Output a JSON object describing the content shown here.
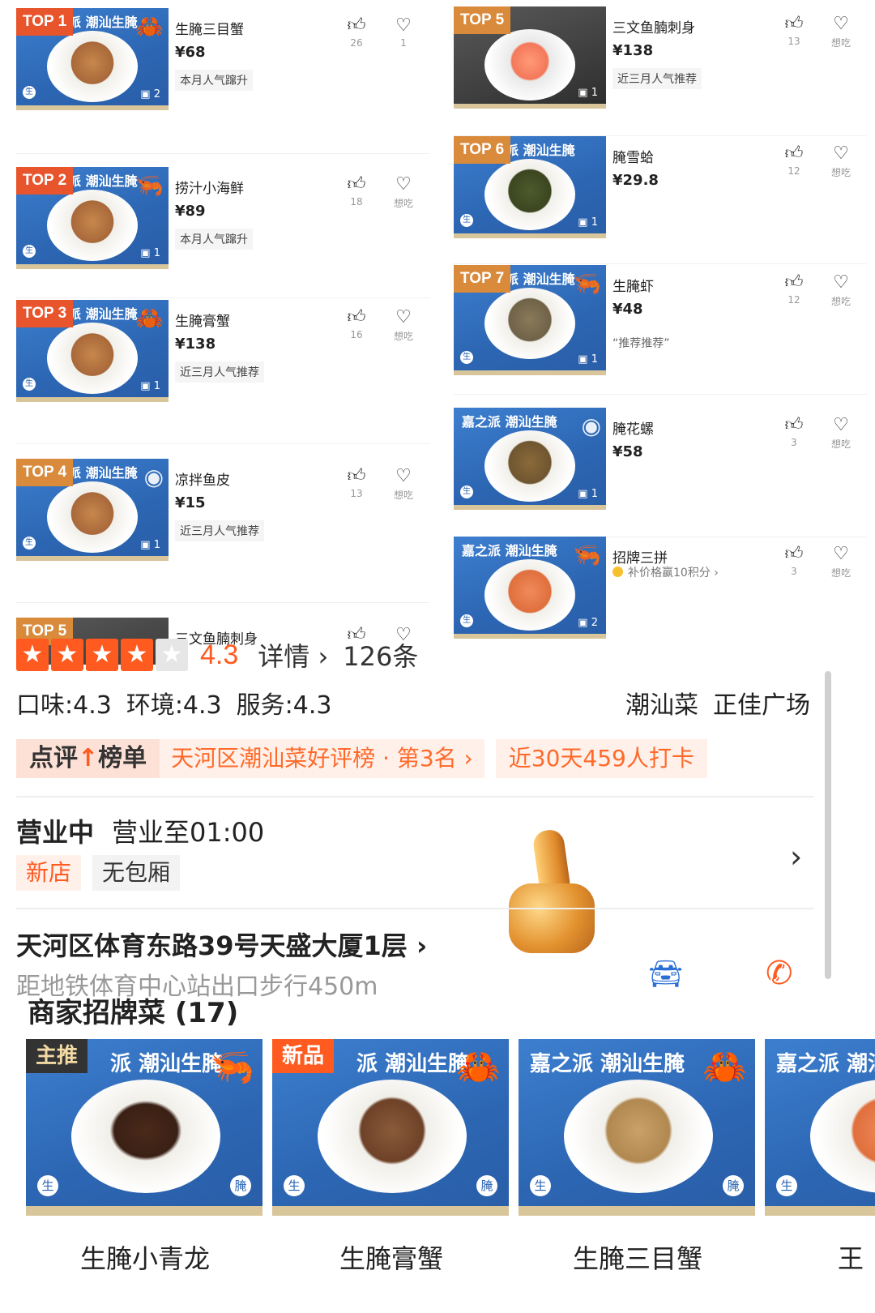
{
  "dish_list": {
    "left": [
      {
        "rank": "TOP 1",
        "name": "生腌三目蟹",
        "price": "¥68",
        "tag": "本月人气蹿升",
        "likes": "26",
        "want": "1",
        "img_count": "2"
      },
      {
        "rank": "TOP 2",
        "name": "捞汁小海鲜",
        "price": "¥89",
        "tag": "本月人气蹿升",
        "likes": "18",
        "want": "想吃",
        "img_count": "1"
      },
      {
        "rank": "TOP 3",
        "name": "生腌膏蟹",
        "price": "¥138",
        "tag": "近三月人气推荐",
        "likes": "16",
        "want": "想吃",
        "img_count": "1"
      },
      {
        "rank": "TOP 4",
        "name": "凉拌鱼皮",
        "price": "¥15",
        "tag": "近三月人气推荐",
        "likes": "13",
        "want": "想吃",
        "img_count": "1"
      },
      {
        "rank": "TOP 5",
        "name": "三文鱼腩刺身",
        "price": "",
        "tag": "",
        "likes": "",
        "want": "",
        "img_count": ""
      }
    ],
    "right": [
      {
        "rank": "TOP 5",
        "name": "三文鱼腩刺身",
        "price": "¥138",
        "tag": "近三月人气推荐",
        "likes": "13",
        "want": "想吃",
        "img_count": "1"
      },
      {
        "rank": "TOP 6",
        "name": "腌雪蛤",
        "price": "¥29.8",
        "tag": "",
        "likes": "12",
        "want": "想吃",
        "img_count": "1"
      },
      {
        "rank": "TOP 7",
        "name": "生腌虾",
        "price": "¥48",
        "tag": "“推荐推荐”",
        "likes": "12",
        "want": "想吃",
        "img_count": "1"
      },
      {
        "rank": "",
        "name": "腌花螺",
        "price": "¥58",
        "tag": "",
        "likes": "3",
        "want": "想吃",
        "img_count": "1"
      },
      {
        "rank": "",
        "name": "招牌三拼",
        "price": "",
        "tag": "补价格赢10积分 ›",
        "likes": "3",
        "want": "想吃",
        "img_count": "2"
      }
    ],
    "brand_text": "派 潮汕生腌",
    "brand_text_full": "嘉之派 潮汕生腌",
    "sheng_label": "生",
    "yan_label": "腌"
  },
  "shop": {
    "stars_filled": 4,
    "stars_total": 5,
    "score": "4.3",
    "details_label": "详情 ›",
    "review_count": "126条",
    "taste": "口味:4.3",
    "environment": "环境:4.3",
    "service": "服务:4.3",
    "cuisine": "潮汕菜",
    "area": "正佳广场",
    "rank_badge_pre": "点评",
    "rank_badge_post": "榜单",
    "rank_text": "天河区潮汕菜好评榜 · 第3名 ›",
    "checkin_text": "近30天459人打卡",
    "status": "营业中",
    "hours": "营业至01:00",
    "tag_new": "新店",
    "tag_room": "无包厢",
    "address": "天河区体育东路39号天盛大厦1层 ›",
    "metro": "距地铁体育中心站出口步行450m"
  },
  "signature": {
    "title": "商家招牌菜 (17)",
    "dishes": [
      {
        "name": "生腌小青龙",
        "badge": "主推",
        "badge_type": "main"
      },
      {
        "name": "生腌膏蟹",
        "badge": "新品",
        "badge_type": "newp"
      },
      {
        "name": "生腌三目蟹",
        "badge": "",
        "badge_type": ""
      },
      {
        "name": "王",
        "badge": "",
        "badge_type": ""
      }
    ]
  },
  "icons": {
    "like": "thumbs-up-outline-icon",
    "want": "heart-plus-icon",
    "car": "car-icon",
    "phone": "phone-icon",
    "chevron": "chevron-right-icon"
  },
  "colors": {
    "accent": "#ff5a1f",
    "brand_blue": "#2c66b3",
    "top_badge": "#e8542b"
  }
}
